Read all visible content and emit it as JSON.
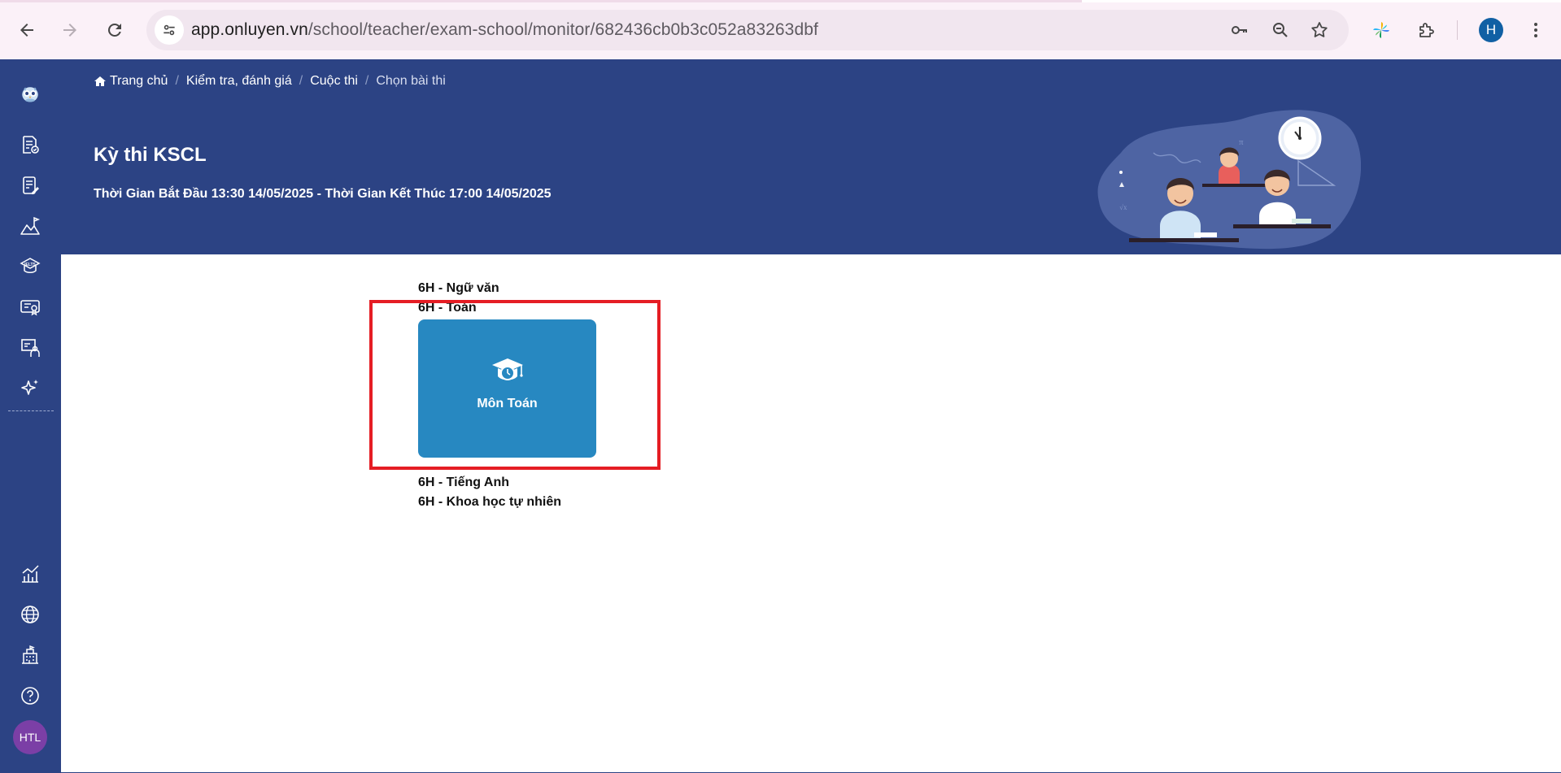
{
  "browser": {
    "url_host": "app.onluyen.vn",
    "url_path": "/school/teacher/exam-school/monitor/682436cb0b3c052a83263dbf",
    "profile_initial": "H"
  },
  "breadcrumb": [
    {
      "label": "Trang chủ"
    },
    {
      "label": "Kiểm tra, đánh giá"
    },
    {
      "label": "Cuộc thi"
    },
    {
      "label": "Chọn bài thi"
    }
  ],
  "exam": {
    "title": "Kỳ thi KSCL",
    "time": "Thời Gian Bắt Đầu 13:30 14/05/2025 - Thời Gian Kết Thúc 17:00 14/05/2025"
  },
  "sidebar": {
    "items": [
      {
        "icon": "exam-document-icon"
      },
      {
        "icon": "assignment-edit-icon"
      },
      {
        "icon": "mountain-chart-icon"
      },
      {
        "icon": "ielts-icon"
      },
      {
        "icon": "certificate-icon"
      },
      {
        "icon": "teacher-board-icon"
      },
      {
        "icon": "ai-sparkle-icon"
      }
    ],
    "bottom_items": [
      {
        "icon": "analytics-chart-icon"
      },
      {
        "icon": "globe-icon"
      },
      {
        "icon": "school-building-icon"
      },
      {
        "icon": "help-icon"
      }
    ],
    "avatar": "HTL"
  },
  "subjects": {
    "items": [
      {
        "label": "6H - Ngữ văn"
      },
      {
        "label": "6H - Toán"
      },
      {
        "label": "6H - Tiếng Anh"
      },
      {
        "label": "6H - Khoa học tự nhiên"
      }
    ],
    "card": {
      "label": "Môn Toán",
      "icon": "graduation-cap-clock-icon"
    }
  },
  "colors": {
    "primary_navy": "#2c4384",
    "card_blue": "#2788c1",
    "highlight_red": "#e51d24"
  }
}
